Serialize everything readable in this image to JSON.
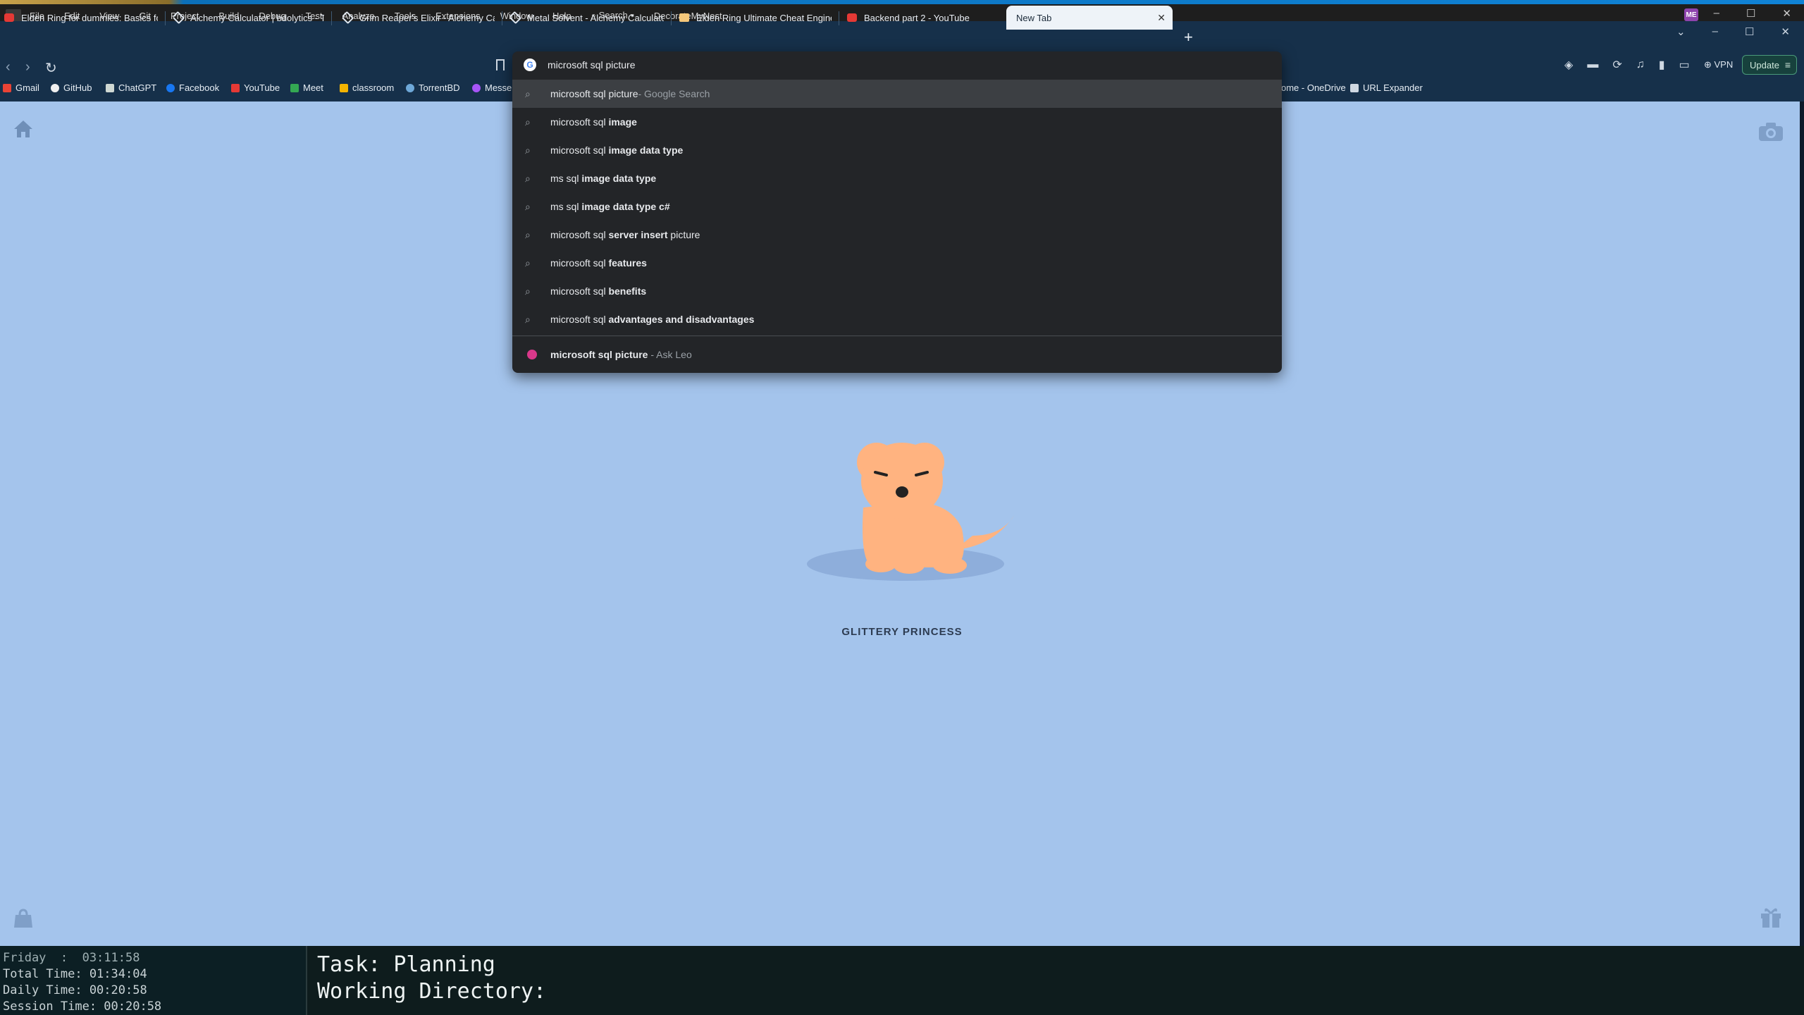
{
  "ide_menu": {
    "items": [
      "File",
      "Edit",
      "View",
      "Git",
      "Project",
      "Build",
      "Debug",
      "Test",
      "Analyze",
      "Tools",
      "Extensions",
      "Window",
      "Help"
    ],
    "search_label": "⌕ Search ▾",
    "solution_name": "DecorateMyNest",
    "avatar": "ME"
  },
  "tabs": [
    {
      "title": "Elden Ring for dummies: Basics for E",
      "icon": "youtube-icon"
    },
    {
      "title": "Alchemy Calculator | bdolytics - The",
      "icon": "alchemy-icon"
    },
    {
      "title": "Grim Reaper's Elixir - Alchemy Calcu",
      "icon": "alchemy-icon"
    },
    {
      "title": "Metal Solvent - Alchemy Calculator |",
      "icon": "alchemy-icon"
    },
    {
      "title": "Elden Ring Ultimate Cheat Engine Ta",
      "icon": "cheat-table-icon"
    },
    {
      "title": "Backend part 2 - YouTube",
      "icon": "youtube-icon"
    },
    {
      "title": "New Tab",
      "icon": "",
      "active": true
    }
  ],
  "toolbar": {
    "vpn_label": "VPN",
    "update_label": "Update"
  },
  "bookmarks": [
    "Gmail",
    "GitHub",
    "ChatGPT",
    "Facebook",
    "YouTube",
    "Meet",
    "classroom",
    "TorrentBD",
    "Messe",
    "ome - OneDrive",
    "URL Expander"
  ],
  "omnibox": {
    "query": "microsoft sql picture ",
    "suggestions": [
      {
        "plain": "microsoft sql picture",
        "bold": "",
        "suffix": " - Google Search"
      },
      {
        "plain": "microsoft sql ",
        "bold": "image",
        "suffix": ""
      },
      {
        "plain": "microsoft sql ",
        "bold": "image data type",
        "suffix": ""
      },
      {
        "plain": "ms sql ",
        "bold": "image data type",
        "suffix": ""
      },
      {
        "plain": "ms sql ",
        "bold": "image data type c#",
        "suffix": ""
      },
      {
        "plain": "microsoft sql ",
        "bold": "server insert",
        "suffix2": " picture"
      },
      {
        "plain": "microsoft sql ",
        "bold": "features",
        "suffix": ""
      },
      {
        "plain": "microsoft sql ",
        "bold": "benefits",
        "suffix": ""
      },
      {
        "plain": "microsoft sql ",
        "bold": "advantages and disadvantages",
        "suffix": ""
      }
    ],
    "site_suggestion": {
      "bold": "microsoft sql picture",
      "suffix": " - Ask Leo"
    }
  },
  "page": {
    "pet_name": "GLITTERY PRINCESS"
  },
  "terminal": {
    "day_line": "Friday  :  03:11:58",
    "total_line": "Total Time: 01:34:04",
    "daily_line": "Daily Time: 00:20:58",
    "session_line": "Session Time: 00:20:58",
    "task_line": "Task: Planning",
    "dir_line": "Working Directory:"
  }
}
